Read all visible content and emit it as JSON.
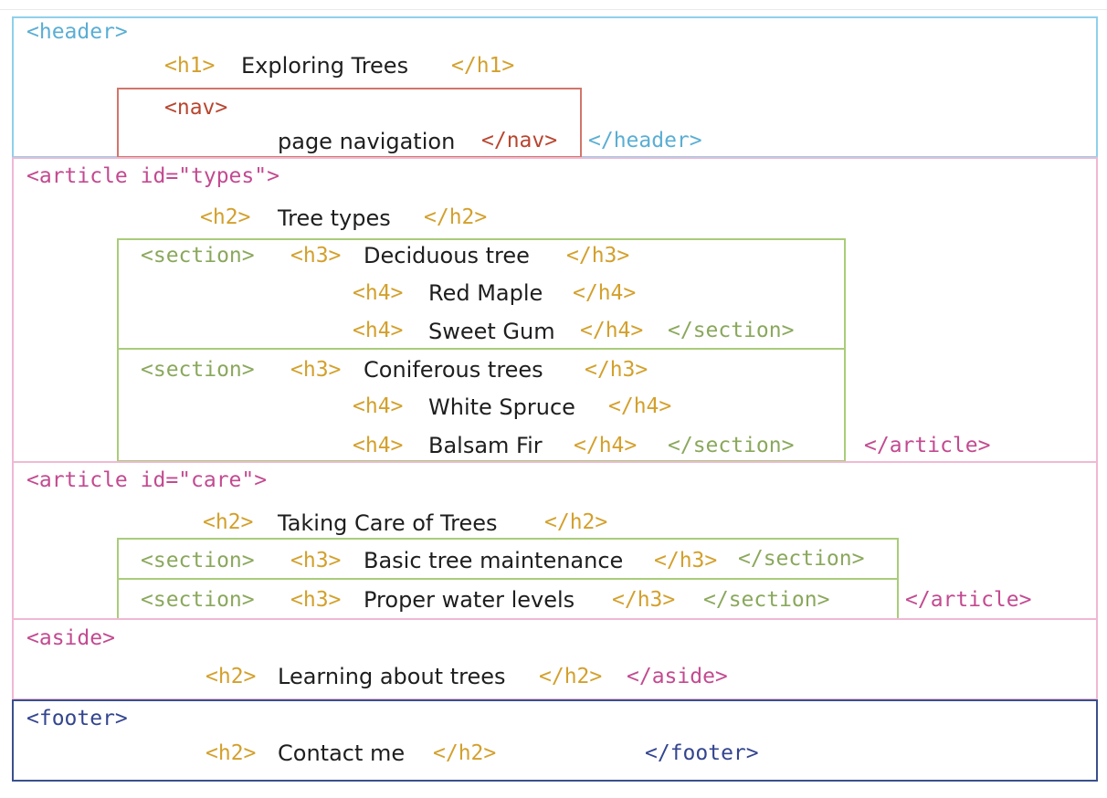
{
  "colors": {
    "header": "#8fd0ec",
    "nav": "#d2756a",
    "article": "#f0b8d4",
    "section": "#a9cc7a",
    "footer": "#3a4f8c",
    "heading_tag": "#d3a02c"
  },
  "header": {
    "open": "<header>",
    "close": "</header>",
    "h1_open": "<h1>",
    "h1_text": "Exploring Trees",
    "h1_close": "</h1>",
    "nav": {
      "open": "<nav>",
      "text": "page navigation",
      "close": "</nav>"
    }
  },
  "article_types": {
    "open": "<article id=\"types\">",
    "close": "</article>",
    "h2_open": "<h2>",
    "h2_text": "Tree types",
    "h2_close": "</h2>",
    "sections": [
      {
        "open": "<section>",
        "h3_open": "<h3>",
        "h3_text": "Deciduous tree",
        "h3_close": "</h3>",
        "h4": [
          {
            "open": "<h4>",
            "text": "Red Maple",
            "close": "</h4>"
          },
          {
            "open": "<h4>",
            "text": "Sweet Gum",
            "close": "</h4>"
          }
        ],
        "close": "</section>"
      },
      {
        "open": "<section>",
        "h3_open": "<h3>",
        "h3_text": "Coniferous trees",
        "h3_close": "</h3>",
        "h4": [
          {
            "open": "<h4>",
            "text": "White Spruce",
            "close": "</h4>"
          },
          {
            "open": "<h4>",
            "text": "Balsam Fir",
            "close": "</h4>"
          }
        ],
        "close": "</section>"
      }
    ]
  },
  "article_care": {
    "open": "<article id=\"care\">",
    "close": "</article>",
    "h2_open": "<h2>",
    "h2_text": "Taking Care of Trees",
    "h2_close": "</h2>",
    "sections": [
      {
        "open": "<section>",
        "h3_open": "<h3>",
        "h3_text": "Basic tree maintenance",
        "h3_close": "</h3>",
        "close": "</section>"
      },
      {
        "open": "<section>",
        "h3_open": "<h3>",
        "h3_text": "Proper water levels",
        "h3_close": "</h3>",
        "close": "</section>"
      }
    ]
  },
  "aside": {
    "open": "<aside>",
    "close": "</aside>",
    "h2_open": "<h2>",
    "h2_text": "Learning about trees",
    "h2_close": "</h2>"
  },
  "footer": {
    "open": "<footer>",
    "close": "</footer>",
    "h2_open": "<h2>",
    "h2_text": "Contact me",
    "h2_close": "</h2>"
  }
}
